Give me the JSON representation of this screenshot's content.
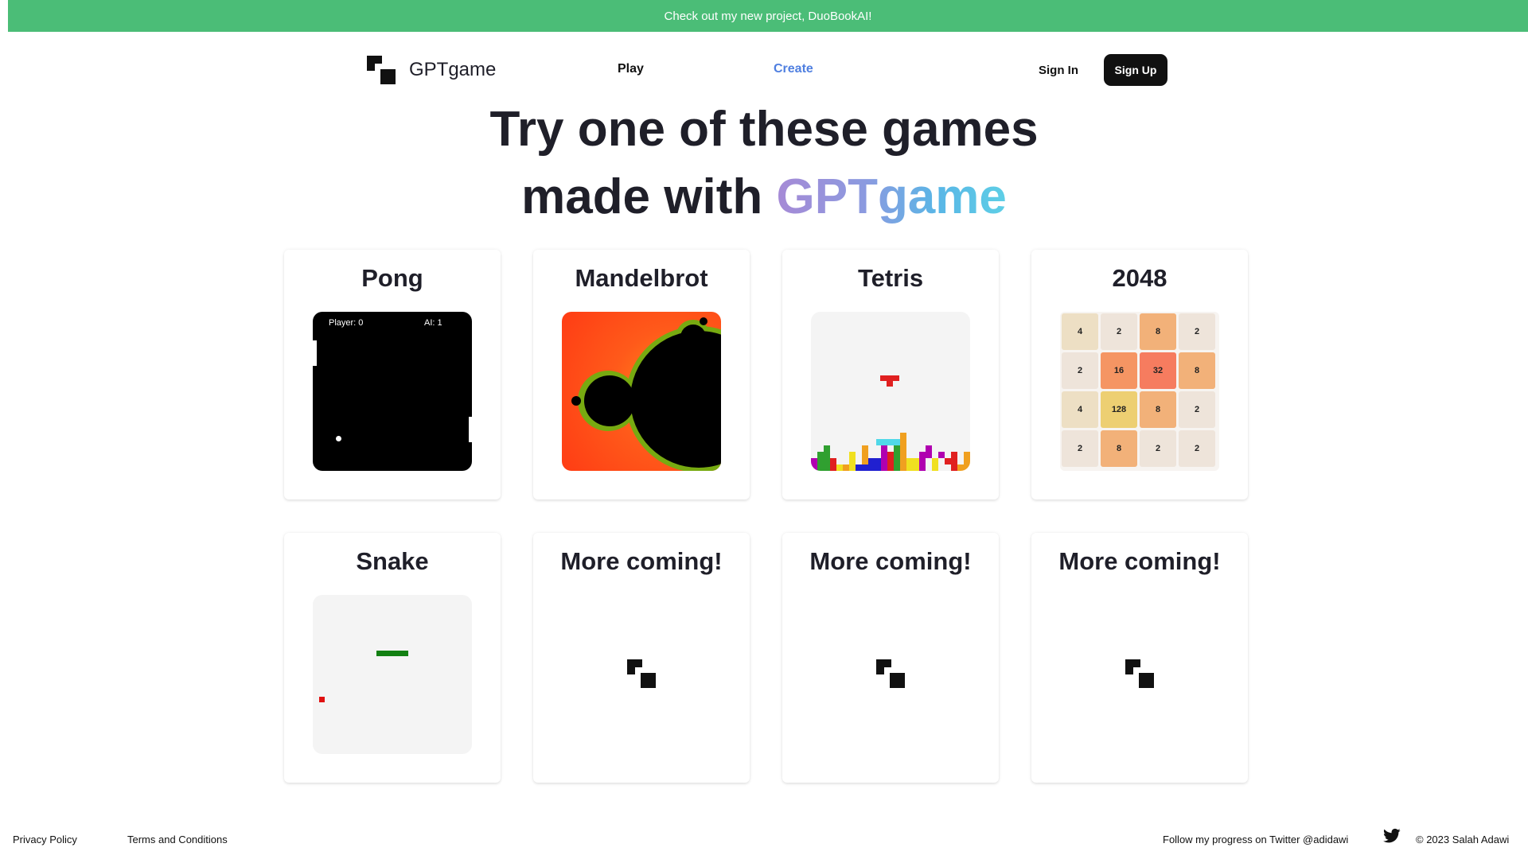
{
  "banner": {
    "text": "Check out my new project, DuoBookAI!"
  },
  "header": {
    "logo_text": "GPTgame",
    "logo_icon": "gptgame-logo-icon",
    "nav": {
      "play": "Play",
      "create": "Create"
    },
    "sign_in": "Sign In",
    "sign_up": "Sign Up"
  },
  "hero": {
    "line1": "Try one of these games",
    "line2_prefix": "made with",
    "line2_brand_a": "GPT",
    "line2_brand_b": "game"
  },
  "games": [
    {
      "title": "Pong",
      "player_score": "Player: 0",
      "ai_score": "AI: 1"
    },
    {
      "title": "Mandelbrot"
    },
    {
      "title": "Tetris"
    },
    {
      "title": "2048",
      "grid": [
        [
          "4",
          "2",
          "8",
          "2"
        ],
        [
          "2",
          "16",
          "32",
          "8"
        ],
        [
          "4",
          "128",
          "8",
          "2"
        ],
        [
          "2",
          "8",
          "2",
          "2"
        ]
      ]
    },
    {
      "title": "Snake"
    },
    {
      "title": "More coming!"
    },
    {
      "title": "More coming!"
    },
    {
      "title": "More coming!"
    }
  ],
  "footer": {
    "privacy": "Privacy Policy",
    "terms": "Terms and Conditions",
    "twitter_text": "Follow my progress on Twitter @adidawi",
    "twitter_icon": "twitter-icon",
    "copyright": "© 2023 Salah Adawi"
  },
  "colors": {
    "banner": "#4bbd77",
    "accent_link": "#4f7fe0",
    "brand_gradient_start": "#a68ad6",
    "brand_gradient_end": "#5ecfe6"
  }
}
